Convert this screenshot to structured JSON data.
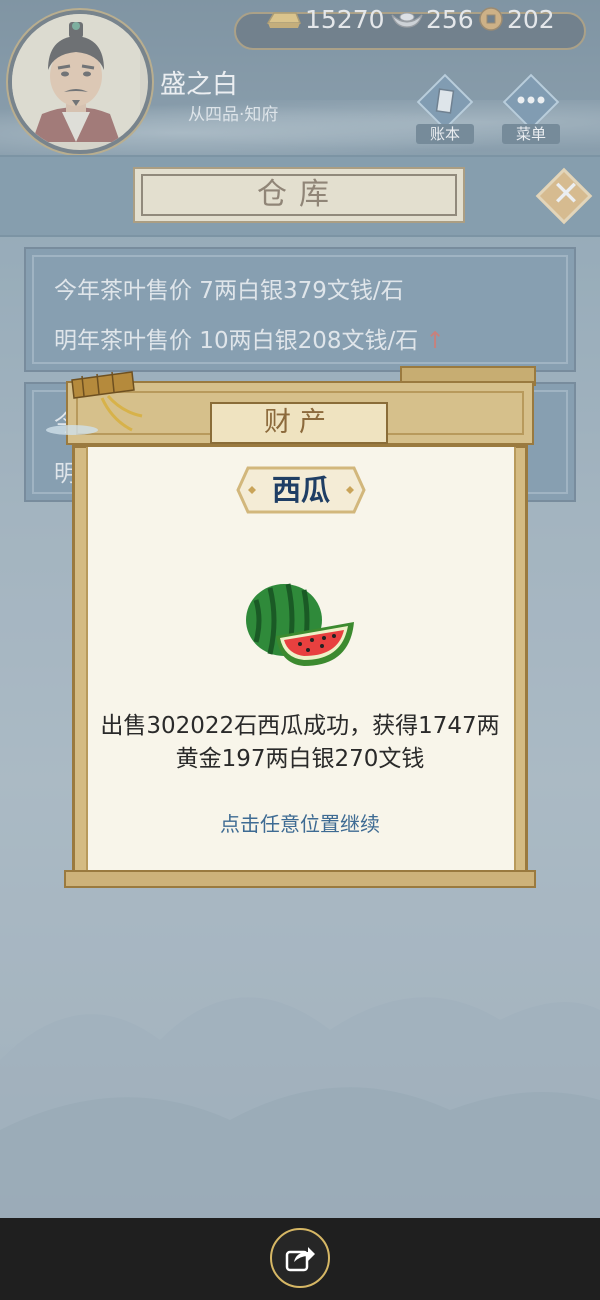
{
  "player": {
    "name": "盛之白",
    "rank": "从四品·知府"
  },
  "currency": {
    "gold": "15270",
    "silver": "256",
    "coins": "202"
  },
  "top_buttons": {
    "ledger_label": "账本",
    "menu_label": "菜单"
  },
  "page": {
    "title": "仓库"
  },
  "panels": [
    {
      "line1": "今年茶叶售价 7两白银379文钱/石",
      "line2": "明年茶叶售价 10两白银208文钱/石",
      "trend": "↑"
    },
    {
      "line1_partial": "今",
      "line2_partial": "明"
    }
  ],
  "dialog": {
    "header": "财产",
    "item_name": "西瓜",
    "message": "出售302022石西瓜成功，获得1747两黄金197两白银270文钱",
    "hint": "点击任意位置继续"
  },
  "icons": {
    "gold": "gold-ingot-icon",
    "silver": "silver-ingot-icon",
    "coin": "copper-coin-icon",
    "ledger": "ledger-icon",
    "menu": "more-dots-icon",
    "close": "close-icon",
    "item": "watermelon-icon",
    "share": "share-icon"
  },
  "colors": {
    "header_blue": "#486d86",
    "parchment": "#f8f5ea",
    "frame_gold": "#d4bb83",
    "trend_red": "#c0392b",
    "hint_blue": "#3e6b93"
  }
}
